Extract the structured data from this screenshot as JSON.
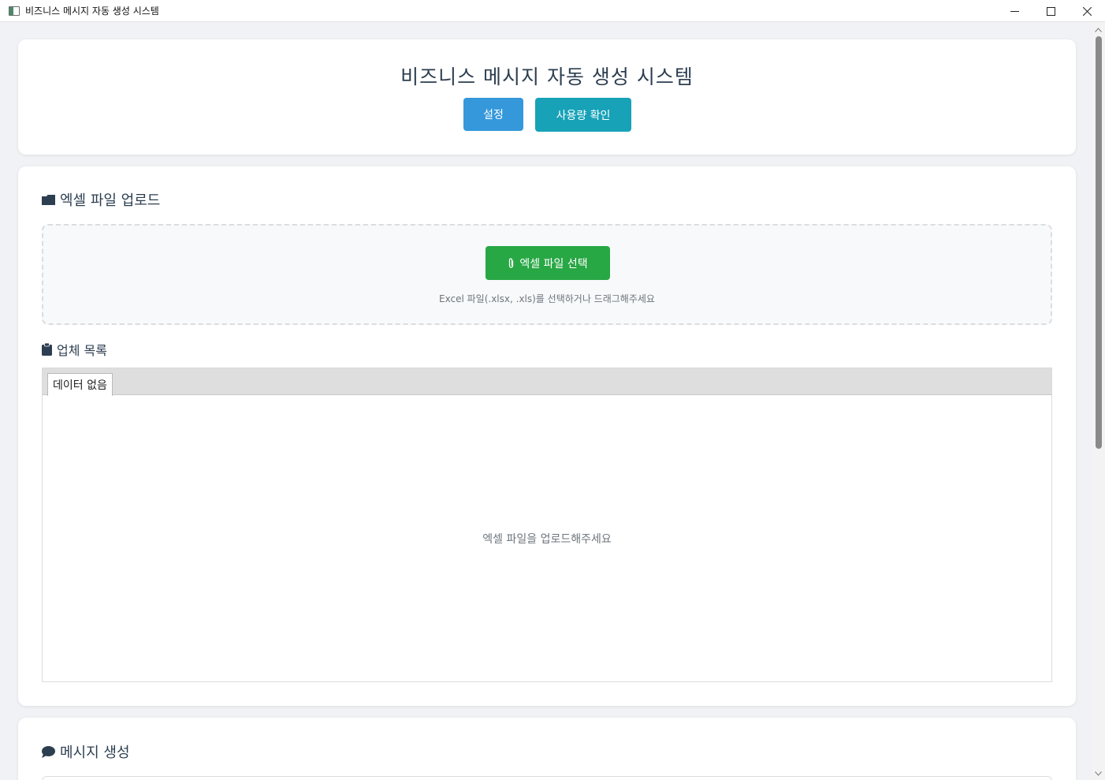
{
  "window": {
    "title": "비즈니스 메시지 자동 생성 시스템"
  },
  "header": {
    "title": "비즈니스 메시지 자동 생성 시스템",
    "settings_label": "설정",
    "usage_label": "사용량 확인"
  },
  "upload": {
    "title": "엑셀 파일 업로드",
    "title_icon": "folder-icon",
    "select_label": "엑셀 파일 선택",
    "select_icon": "paperclip-icon",
    "hint": "Excel 파일(.xlsx, .xls)를 선택하거나 드래그해주세요"
  },
  "companies": {
    "title": "업체 목록",
    "title_icon": "clipboard-icon",
    "tab_label": "데이터 없음",
    "empty_message": "엑셀 파일을 업로드해주세요"
  },
  "message": {
    "title": "메시지 생성",
    "title_icon": "speech-bubble-icon"
  },
  "colors": {
    "primary": "#3498db",
    "info": "#17a2b8",
    "success": "#28a745",
    "heading": "#2c3e50",
    "muted": "#6c757d"
  }
}
